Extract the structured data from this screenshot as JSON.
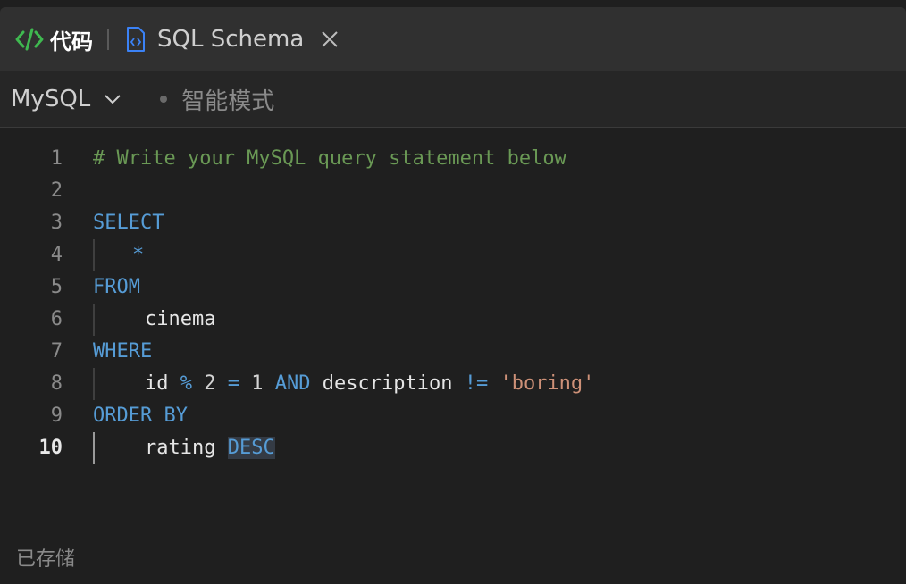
{
  "tabs": {
    "code_label": "代码",
    "file_label": "SQL Schema"
  },
  "toolbar": {
    "language": "MySQL",
    "mode": "智能模式"
  },
  "editor": {
    "lines": [
      {
        "num": "1",
        "tokens": [
          "# Write your MySQL query statement below"
        ]
      },
      {
        "num": "2",
        "tokens": []
      },
      {
        "num": "3",
        "tokens": [
          "SELECT"
        ]
      },
      {
        "num": "4",
        "tokens": [
          "*"
        ]
      },
      {
        "num": "5",
        "tokens": [
          "FROM"
        ]
      },
      {
        "num": "6",
        "tokens": [
          "cinema"
        ]
      },
      {
        "num": "7",
        "tokens": [
          "WHERE"
        ]
      },
      {
        "num": "8",
        "tokens": [
          "id",
          "%",
          "2",
          "=",
          "1",
          "AND",
          "description",
          "!=",
          "'boring'"
        ]
      },
      {
        "num": "9",
        "tokens": [
          "ORDER BY"
        ]
      },
      {
        "num": "10",
        "tokens": [
          "rating",
          "DESC"
        ]
      }
    ]
  },
  "status": {
    "saved": "已存储"
  },
  "colors": {
    "keyword": "#569cd6",
    "comment": "#6a9955",
    "string": "#ce9178",
    "code_icon": "#3fb950",
    "file_icon": "#3b82f6"
  }
}
